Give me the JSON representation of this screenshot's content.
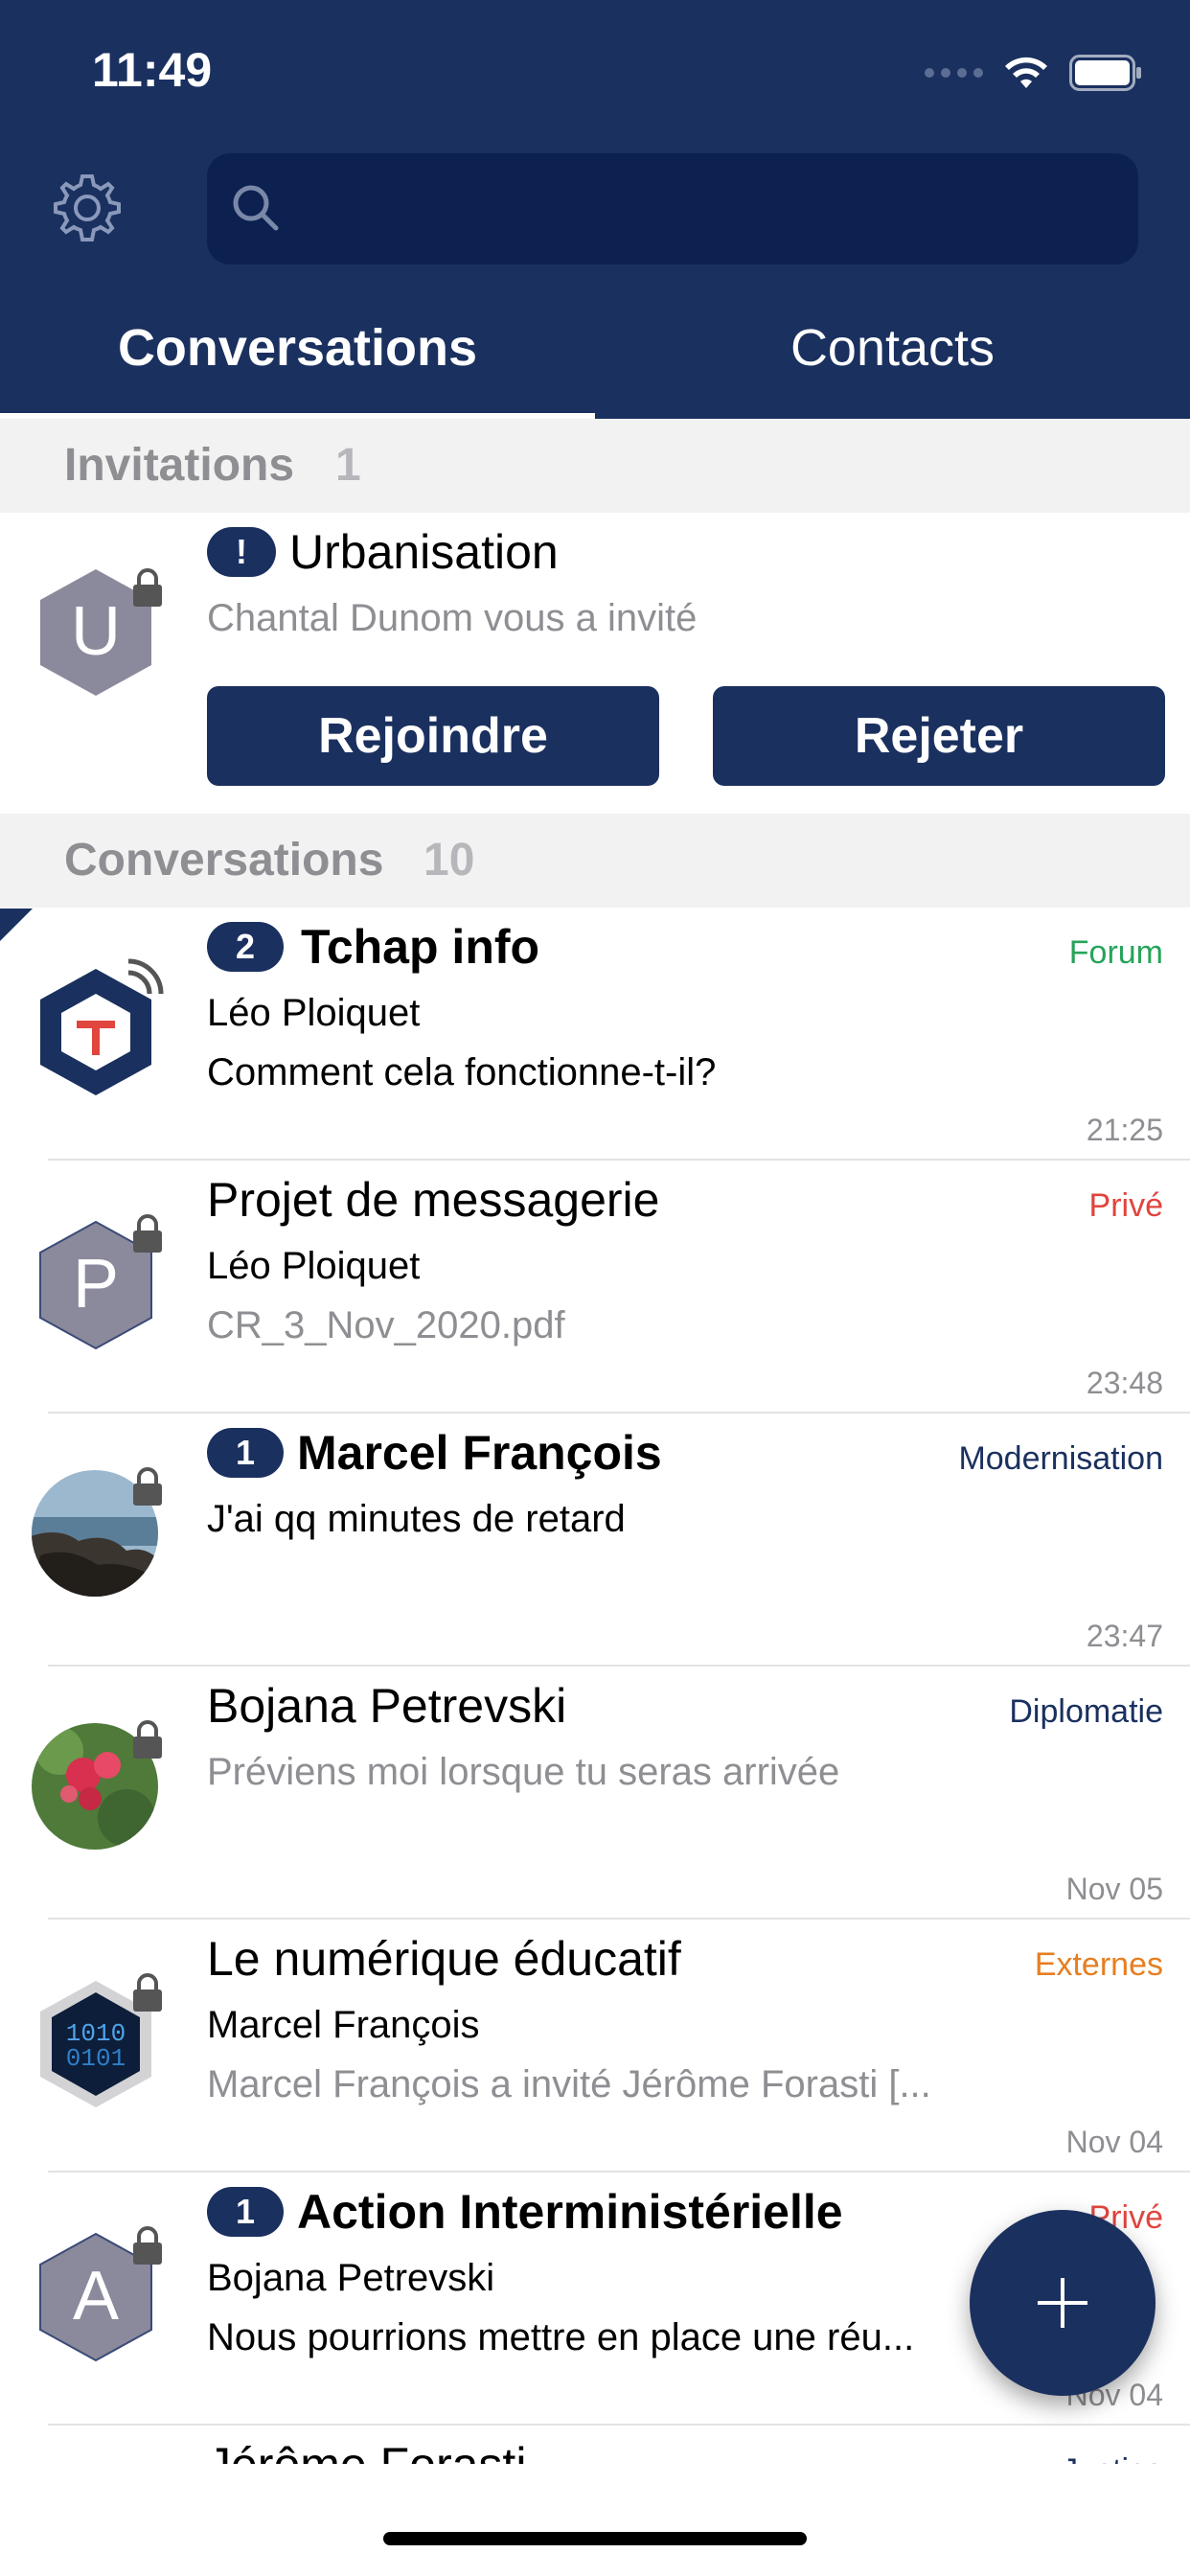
{
  "status_bar": {
    "time": "11:49"
  },
  "header": {
    "search": {
      "value": "",
      "placeholder": ""
    },
    "tabs": [
      {
        "label": "Conversations",
        "active": true
      },
      {
        "label": "Contacts",
        "active": false
      }
    ]
  },
  "colors": {
    "brand": "#1a305f",
    "forum": "#27a35a",
    "prive": "#e0453e",
    "externes": "#e67e22",
    "agency": "#1a305f"
  },
  "invitations": {
    "title": "Invitations",
    "count": "1",
    "items": [
      {
        "avatar_letter": "U",
        "badge": "!",
        "name": "Urbanisation",
        "subtitle": "Chantal Dunom vous a invité",
        "join_label": "Rejoindre",
        "reject_label": "Rejeter"
      }
    ]
  },
  "conversations": {
    "title": "Conversations",
    "count": "10",
    "items": [
      {
        "badge": "2",
        "name": "Tchap info",
        "line1": "Léo Ploiquet",
        "line2": "Comment cela fonctionne-t-il?",
        "domain": "Forum",
        "time": "21:25",
        "avatar": "tchap-logo"
      },
      {
        "badge": "",
        "name": "Projet de messagerie",
        "line1": "Léo Ploiquet",
        "line2": "CR_3_Nov_2020.pdf",
        "domain": "Privé",
        "time": "23:48",
        "avatar_letter": "P"
      },
      {
        "badge": "1",
        "name": "Marcel François",
        "line1": "J'ai qq minutes de retard",
        "line2": "",
        "domain": "Modernisation",
        "time": "23:47",
        "avatar": "photo-coast"
      },
      {
        "badge": "",
        "name": "Bojana Petrevski",
        "line1": "Préviens moi lorsque tu seras arrivée",
        "line2": "",
        "domain": "Diplomatie",
        "time": "Nov 05",
        "avatar": "photo-flowers"
      },
      {
        "badge": "",
        "name": "Le numérique éducatif",
        "line1": "Marcel François",
        "line2": "Marcel François a invité Jérôme Forasti [...",
        "domain": "Externes",
        "time": "Nov 04",
        "avatar": "binary-hexagon"
      },
      {
        "badge": "1",
        "name": "Action Interministérielle",
        "line1": "Bojana Petrevski",
        "line2": "Nous pourrions mettre en place une réu...",
        "domain": "Privé",
        "time": "Nov 04",
        "avatar_letter": "A"
      },
      {
        "badge": "",
        "name": "Jérôme Forasti",
        "line1": "",
        "line2": "",
        "domain": "Justice",
        "time": ""
      }
    ]
  },
  "fab": {
    "icon": "plus-icon"
  }
}
